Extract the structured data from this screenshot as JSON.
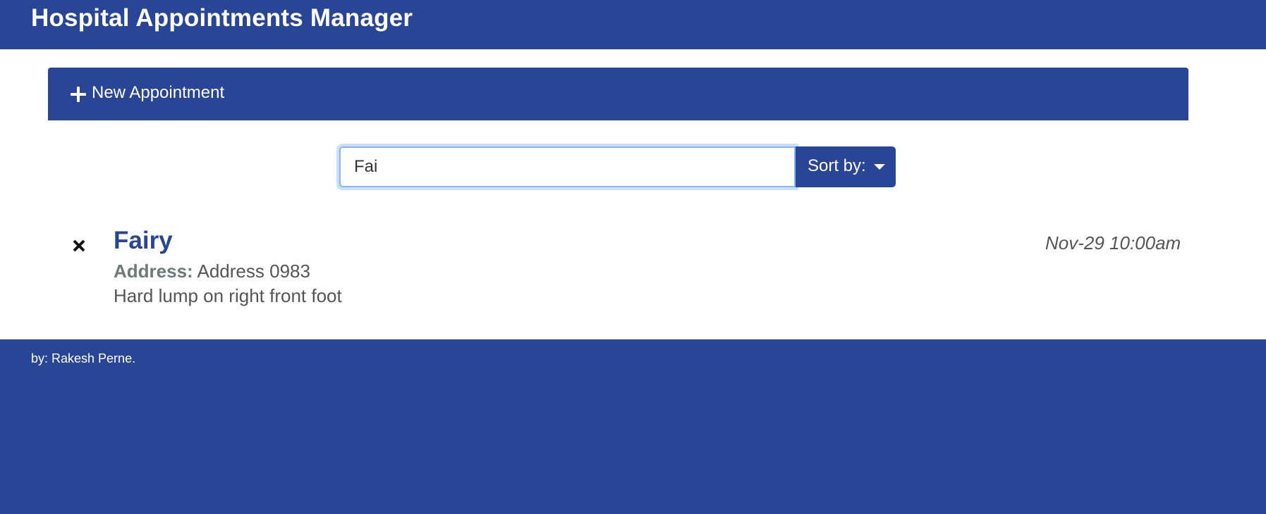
{
  "header": {
    "title": "Hospital Appointments Manager"
  },
  "add_panel": {
    "label": "New Appointment",
    "icon": "plus-icon"
  },
  "search": {
    "value": "Fai",
    "sort_label": "Sort by:",
    "caret_icon": "caret-down-icon"
  },
  "appointments": [
    {
      "name": "Fairy",
      "date": "Nov-29 10:00am",
      "address_label": "Address:",
      "address": "Address 0983",
      "notes": "Hard lump on right front foot",
      "delete_icon": "close-icon"
    }
  ],
  "footer": {
    "text": "by: Rakesh Perne."
  },
  "colors": {
    "brand": "#294595",
    "input_focus": "#86b7fe",
    "text": "#555555"
  }
}
